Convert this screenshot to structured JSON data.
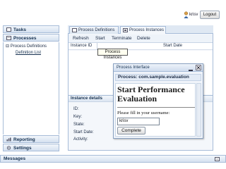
{
  "header": {
    "username": "krisv",
    "logout_label": "Logout"
  },
  "sidebar": {
    "tasks": "Tasks",
    "processes": "Processes",
    "tree_item": "Process Definitions",
    "tree_link": "Definition List",
    "reporting": "Reporting",
    "settings": "Settings"
  },
  "tabs": [
    {
      "label": "Process Definitions"
    },
    {
      "label": "Process Instances"
    }
  ],
  "toolbar": {
    "refresh": "Refresh",
    "start": "Start",
    "terminate": "Terminate",
    "delete": "Delete"
  },
  "grid": {
    "col_instance_id": "Instance ID",
    "col_start_date": "Start Date",
    "tooltip": "Process Instances"
  },
  "details": {
    "title": "Instance details",
    "labels": [
      "ID:",
      "Key:",
      "State:",
      "Start Date:",
      "Activity:"
    ]
  },
  "dialog": {
    "title": "Process Interface",
    "process_label": "Process: com.sample.evaluation",
    "form_heading": "Start Performance Evaluation",
    "form_label": "Please fill in your username:",
    "input_value": "krisv",
    "submit_label": "Complete"
  },
  "footer": {
    "messages": "Messages"
  },
  "colors": {
    "border": "#a7bcd8",
    "header_grad": "#d5e1f0",
    "text": "#15304f"
  }
}
